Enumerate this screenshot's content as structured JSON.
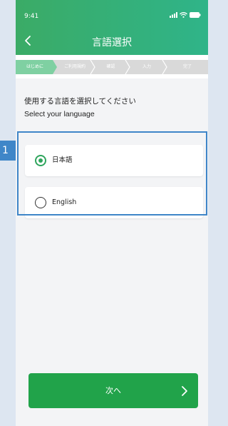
{
  "annotation": {
    "callout_number": "1"
  },
  "status_bar": {
    "time": "9:41"
  },
  "header": {
    "title": "言語選択"
  },
  "steps": [
    {
      "label": "はじめに",
      "state": "active"
    },
    {
      "label": "ご利用規約",
      "state": "inactive"
    },
    {
      "label": "確認",
      "state": "inactive"
    },
    {
      "label": "入力",
      "state": "inactive"
    },
    {
      "label": "完了",
      "state": "inactive"
    }
  ],
  "content": {
    "prompt_ja": "使用する言語を選択してください",
    "prompt_en": "Select your language",
    "options": [
      {
        "label": "日本語",
        "selected": true
      },
      {
        "label": "English",
        "selected": false
      }
    ]
  },
  "footer": {
    "next_label": "次へ"
  },
  "colors": {
    "header_gradient_start": "#3bab66",
    "header_gradient_end": "#2fb489",
    "accent": "#2fa55d",
    "button": "#21a34a",
    "callout": "#3f86c8",
    "step_active": "#7fd0a2",
    "step_inactive": "#d9d9d9"
  }
}
